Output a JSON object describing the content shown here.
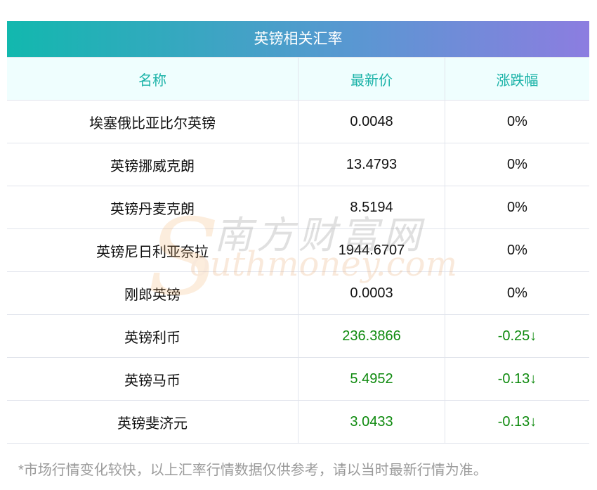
{
  "title": "英镑相关汇率",
  "columns": [
    "名称",
    "最新价",
    "涨跌幅"
  ],
  "rows": [
    {
      "name": "埃塞俄比亚比尔英镑",
      "price": "0.0048",
      "change": "0%",
      "trend": "flat"
    },
    {
      "name": "英镑挪威克朗",
      "price": "13.4793",
      "change": "0%",
      "trend": "flat"
    },
    {
      "name": "英镑丹麦克朗",
      "price": "8.5194",
      "change": "0%",
      "trend": "flat"
    },
    {
      "name": "英镑尼日利亚奈拉",
      "price": "1944.6707",
      "change": "0%",
      "trend": "flat"
    },
    {
      "name": "刚郎英镑",
      "price": "0.0003",
      "change": "0%",
      "trend": "flat"
    },
    {
      "name": "英镑利币",
      "price": "236.3866",
      "change": "-0.25↓",
      "trend": "down"
    },
    {
      "name": "英镑马币",
      "price": "5.4952",
      "change": "-0.13↓",
      "trend": "down"
    },
    {
      "name": "英镑斐济元",
      "price": "3.0433",
      "change": "-0.13↓",
      "trend": "down"
    }
  ],
  "note": "*市场行情变化较快，以上汇率行情数据仅供参考，请以当时最新行情为准。",
  "watermark": {
    "cn": "南方财富网",
    "en": "outhmoney.com",
    "s": "S"
  },
  "colors": {
    "down": "#0e8a0e",
    "header_text": "#1bb3a8",
    "gradient_start": "#12b8ae",
    "gradient_end": "#8c7de0"
  }
}
